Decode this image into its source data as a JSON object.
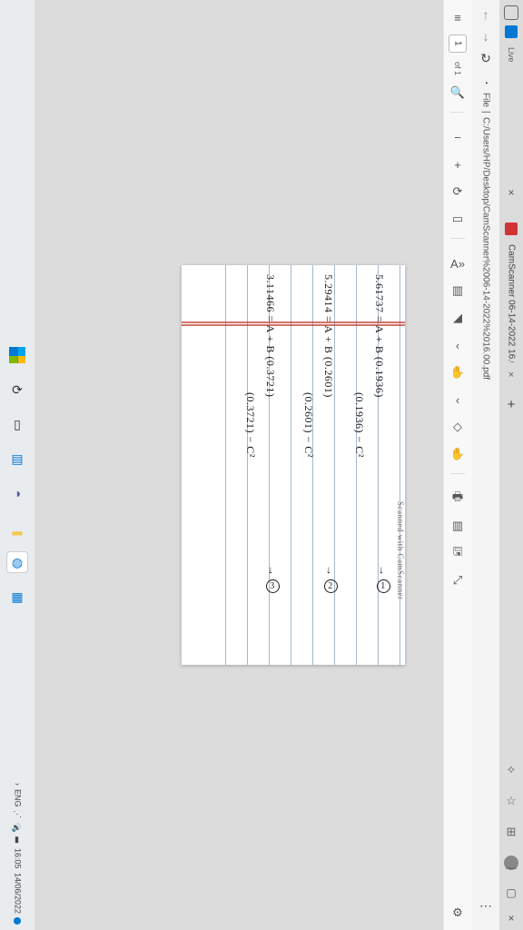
{
  "taskbar": {
    "apps": [
      "start",
      "search",
      "task-view",
      "widgets",
      "explorer",
      "teams",
      "explorer2",
      "edge",
      "store"
    ],
    "tray": {
      "chevron": "›",
      "lang": "ENG",
      "time": "16:05",
      "date": "14/06/2022"
    }
  },
  "edge": {
    "tabs_button": "Tabs",
    "live": "Live",
    "tab_title": "CamScanner 06-14-2022 16.00",
    "sidebar": [
      "favorites-icon",
      "collections-icon",
      "share-icon"
    ],
    "profile": "Profile",
    "window_controls": [
      "minimize",
      "maximize",
      "close"
    ]
  },
  "nav": {
    "back": "←",
    "forward": "→",
    "refresh": "↻",
    "scheme": "File",
    "sep": " | ",
    "path": "C:/Users/HP/Desktop/CamScanner%2006-14-2022%2016.00.pdf",
    "more": "⋯"
  },
  "pdf_toolbar": {
    "contents": "≡",
    "page_current": "1",
    "page_of": "of 1",
    "search": "🔍",
    "zoom_out": "−",
    "zoom_in": "+",
    "rotate": "⟳",
    "fit": "▭",
    "read_aloud": "A»",
    "draw": "✎",
    "highlight": "◢",
    "erase": "◇",
    "ask": "✋",
    "print": "🖶",
    "two_page": "▥",
    "save": "🖫",
    "full": "⤢",
    "settings": "⚙"
  },
  "document": {
    "lines": [
      "5.61737 = A + B (0.1936)",
      "(0.1936) − C²",
      "5.29414 = A + B (0.2601)",
      "(0.2601) − C²",
      "3.11466 = A + B (0.3721)",
      "(0.3721) − C²"
    ],
    "markers": [
      "①",
      "②",
      "③"
    ],
    "arrow": "→",
    "watermark": "Scanned with CamScanner"
  }
}
